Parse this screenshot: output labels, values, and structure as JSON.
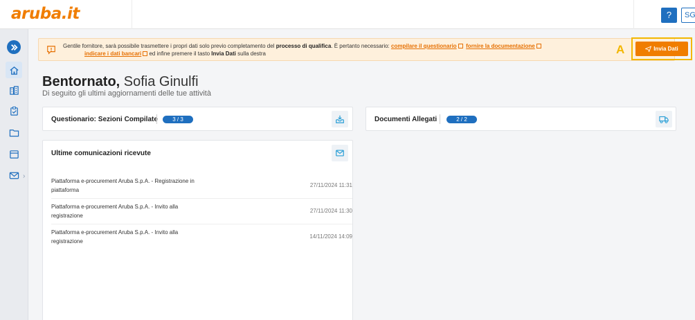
{
  "app": {
    "logo_text": "aruba.it",
    "help_label": "?",
    "user_initials": "SG"
  },
  "banner": {
    "text_1": "Gentile fornitore, sarà possibile trasmettere i propri dati solo previo completamento del ",
    "bold_1": "processo di qualifica",
    "text_2": ". È pertanto necessario: ",
    "link_1": "compilare il questionario",
    "link_2": "fornire la documentazione",
    "link_3": "indicare i dati bancari",
    "text_3": " ed infine premere il tasto ",
    "bold_2": "Invia Dati",
    "text_4": " sulla destra",
    "annotation": "A",
    "send_label": "Invia Dati"
  },
  "welcome": {
    "greeting": "Bentornato,",
    "name": " Sofia Ginulfi",
    "subtitle": "Di seguito gli ultimi aggiornamenti delle tue attività"
  },
  "cards": {
    "questionnaire": {
      "title": "Questionario: Sezioni Compilate",
      "badge": "3 / 3"
    },
    "documents": {
      "title": "Documenti Allegati",
      "badge": "2 / 2"
    },
    "messages": {
      "title": "Ultime comunicazioni ricevute",
      "items": [
        {
          "text": "Piattaforma e-procurement Aruba S.p.A. - Registrazione in piattaforma",
          "date": "27/11/2024 11:31"
        },
        {
          "text": "Piattaforma e-procurement Aruba S.p.A. - Invito alla registrazione",
          "date": "27/11/2024 11:30"
        },
        {
          "text": "Piattaforma e-procurement Aruba S.p.A. - Invito alla registrazione",
          "date": "14/11/2024 14:09"
        }
      ]
    }
  },
  "colors": {
    "accent": "#1f6fbf",
    "brand_orange": "#f07d00",
    "highlight_yellow": "#f3b700",
    "banner_bg": "#fef0dc"
  },
  "icons": {
    "sidebar": [
      "expand-icon",
      "home-icon",
      "building-icon",
      "clipboard-icon",
      "folder-icon",
      "calendar-icon",
      "mail-icon"
    ],
    "cards": [
      "inbox-download-icon",
      "truck-icon",
      "envelope-icon"
    ],
    "banner": [
      "info-icon",
      "send-icon"
    ]
  }
}
